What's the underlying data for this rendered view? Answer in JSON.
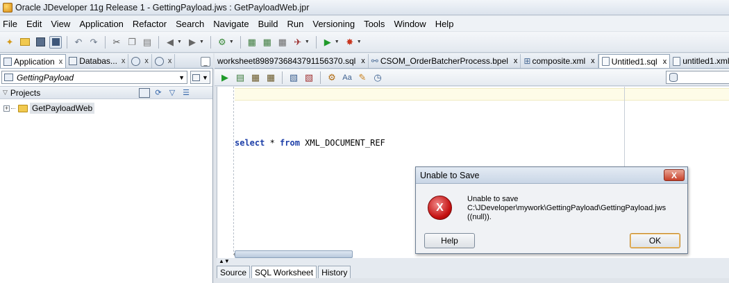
{
  "window": {
    "title": "Oracle JDeveloper 11g Release 1 - GettingPayload.jws : GetPayloadWeb.jpr"
  },
  "menu": {
    "items": [
      "File",
      "Edit",
      "View",
      "Application",
      "Refactor",
      "Search",
      "Navigate",
      "Build",
      "Run",
      "Versioning",
      "Tools",
      "Window",
      "Help"
    ]
  },
  "left_panel": {
    "tabs": [
      {
        "label": "Application",
        "active": true
      },
      {
        "label": "Databas...",
        "active": false
      }
    ],
    "app_selector_value": "GettingPayload",
    "projects_header": "Projects",
    "tree": [
      {
        "label": "GetPayloadWeb"
      }
    ]
  },
  "editor": {
    "tabs": [
      {
        "label": "worksheet8989736843791156370.sql",
        "active": false
      },
      {
        "label": "CSOM_OrderBatcherProcess.bpel",
        "active": false
      },
      {
        "label": "composite.xml",
        "active": false
      },
      {
        "label": "Untitled1.sql",
        "active": true
      },
      {
        "label": "untitled1.xml",
        "active": false
      }
    ],
    "sql": {
      "kw1": "select",
      "mid": " * ",
      "kw2": "from",
      "rest": " XML_DOCUMENT_REF"
    },
    "bottom_tabs": [
      {
        "label": "Source",
        "active": false
      },
      {
        "label": "SQL Worksheet",
        "active": true
      },
      {
        "label": "History",
        "active": false
      }
    ]
  },
  "dialog": {
    "title": "Unable to Save",
    "message_lines": [
      "Unable to save",
      "C:\\JDeveloper\\mywork\\GettingPayload\\GettingPayload.jws",
      "((null))."
    ],
    "help_label": "Help",
    "ok_label": "OK",
    "close_label": "X",
    "icon_label": "X"
  },
  "icons": {
    "close": "x-icon",
    "error": "error-icon"
  },
  "colors": {
    "error_red": "#c40f0f",
    "close_red": "#c7412a",
    "sql_keyword": "#1d3fa8"
  }
}
